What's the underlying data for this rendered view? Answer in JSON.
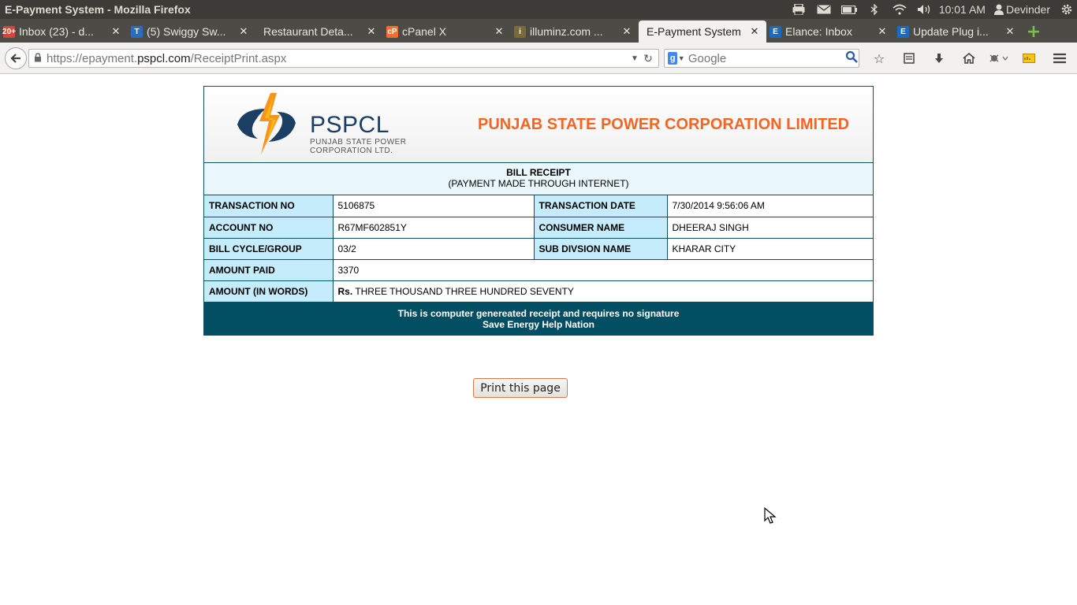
{
  "os": {
    "window_title": "E-Payment System - Mozilla Firefox",
    "clock": "10:01 AM",
    "user": "Devinder",
    "tray_icons": [
      "printer-icon",
      "mail-icon",
      "battery-icon",
      "bluetooth-icon",
      "wifi-icon",
      "volume-icon",
      "user-icon",
      "settings-gear-icon"
    ]
  },
  "tabs": [
    {
      "label": "Inbox (23) - d...",
      "favicon": "gmail-icon",
      "favicon_text": "20+",
      "favicon_color": "#d44638",
      "active": false
    },
    {
      "label": "(5) Swiggy Sw...",
      "favicon": "trello-icon",
      "favicon_text": "T",
      "favicon_color": "#2a6ebb",
      "active": false
    },
    {
      "label": "Restaurant Deta...",
      "favicon": "",
      "favicon_text": "",
      "favicon_color": "",
      "active": false
    },
    {
      "label": "cPanel X",
      "favicon": "cpanel-icon",
      "favicon_text": "cP",
      "favicon_color": "#ff6c2c",
      "active": false
    },
    {
      "label": "illuminz.com ...",
      "favicon": "illuminz-icon",
      "favicon_text": "i",
      "favicon_color": "#7a6a3a",
      "active": false
    },
    {
      "label": "E-Payment System",
      "favicon": "",
      "favicon_text": "",
      "favicon_color": "",
      "active": true
    },
    {
      "label": "Elance: Inbox",
      "favicon": "elance-icon",
      "favicon_text": "E",
      "favicon_color": "#1c6bbf",
      "active": false
    },
    {
      "label": "Update Plug i...",
      "favicon": "elance-icon",
      "favicon_text": "E",
      "favicon_color": "#1c6bbf",
      "active": false
    }
  ],
  "nav": {
    "url_prefix": "https://epayment.",
    "url_domain": "pspcl.com",
    "url_path": "/ReceiptPrint.aspx",
    "search_placeholder": "Google"
  },
  "receipt": {
    "logo_name": "PSPCL",
    "logo_sub1": "PUNJAB STATE POWER",
    "logo_sub2": "CORPORATION LTD.",
    "corp_name": "PUNJAB STATE POWER CORPORATION LIMITED",
    "title": "BILL RECEIPT",
    "subtitle": "(PAYMENT MADE THROUGH INTERNET)",
    "rows": {
      "transaction_no_label": "TRANSACTION NO",
      "transaction_no": "5106875",
      "transaction_date_label": "TRANSACTION DATE",
      "transaction_date": "7/30/2014 9:56:06 AM",
      "account_no_label": "ACCOUNT NO",
      "account_no": "R67MF602851Y",
      "consumer_name_label": "CONSUMER NAME",
      "consumer_name": "DHEERAJ SINGH",
      "bill_cycle_label": "BILL CYCLE/GROUP",
      "bill_cycle": "03/2",
      "sub_division_label": "SUB DIVSION NAME",
      "sub_division": "KHARAR CITY",
      "amount_paid_label": "AMOUNT PAID",
      "amount_paid": "3370",
      "amount_words_label": "AMOUNT (IN WORDS)",
      "amount_words_prefix": "Rs.",
      "amount_words": "THREE THOUSAND THREE HUNDRED SEVENTY"
    },
    "footer_line1": "This is computer genereated receipt and requires no signature",
    "footer_line2": "Save Energy Help Nation"
  },
  "print_button": "Print this page",
  "colors": {
    "brand_orange": "#f26522",
    "brand_teal": "#024f63",
    "label_bg": "#c5ecfa"
  }
}
